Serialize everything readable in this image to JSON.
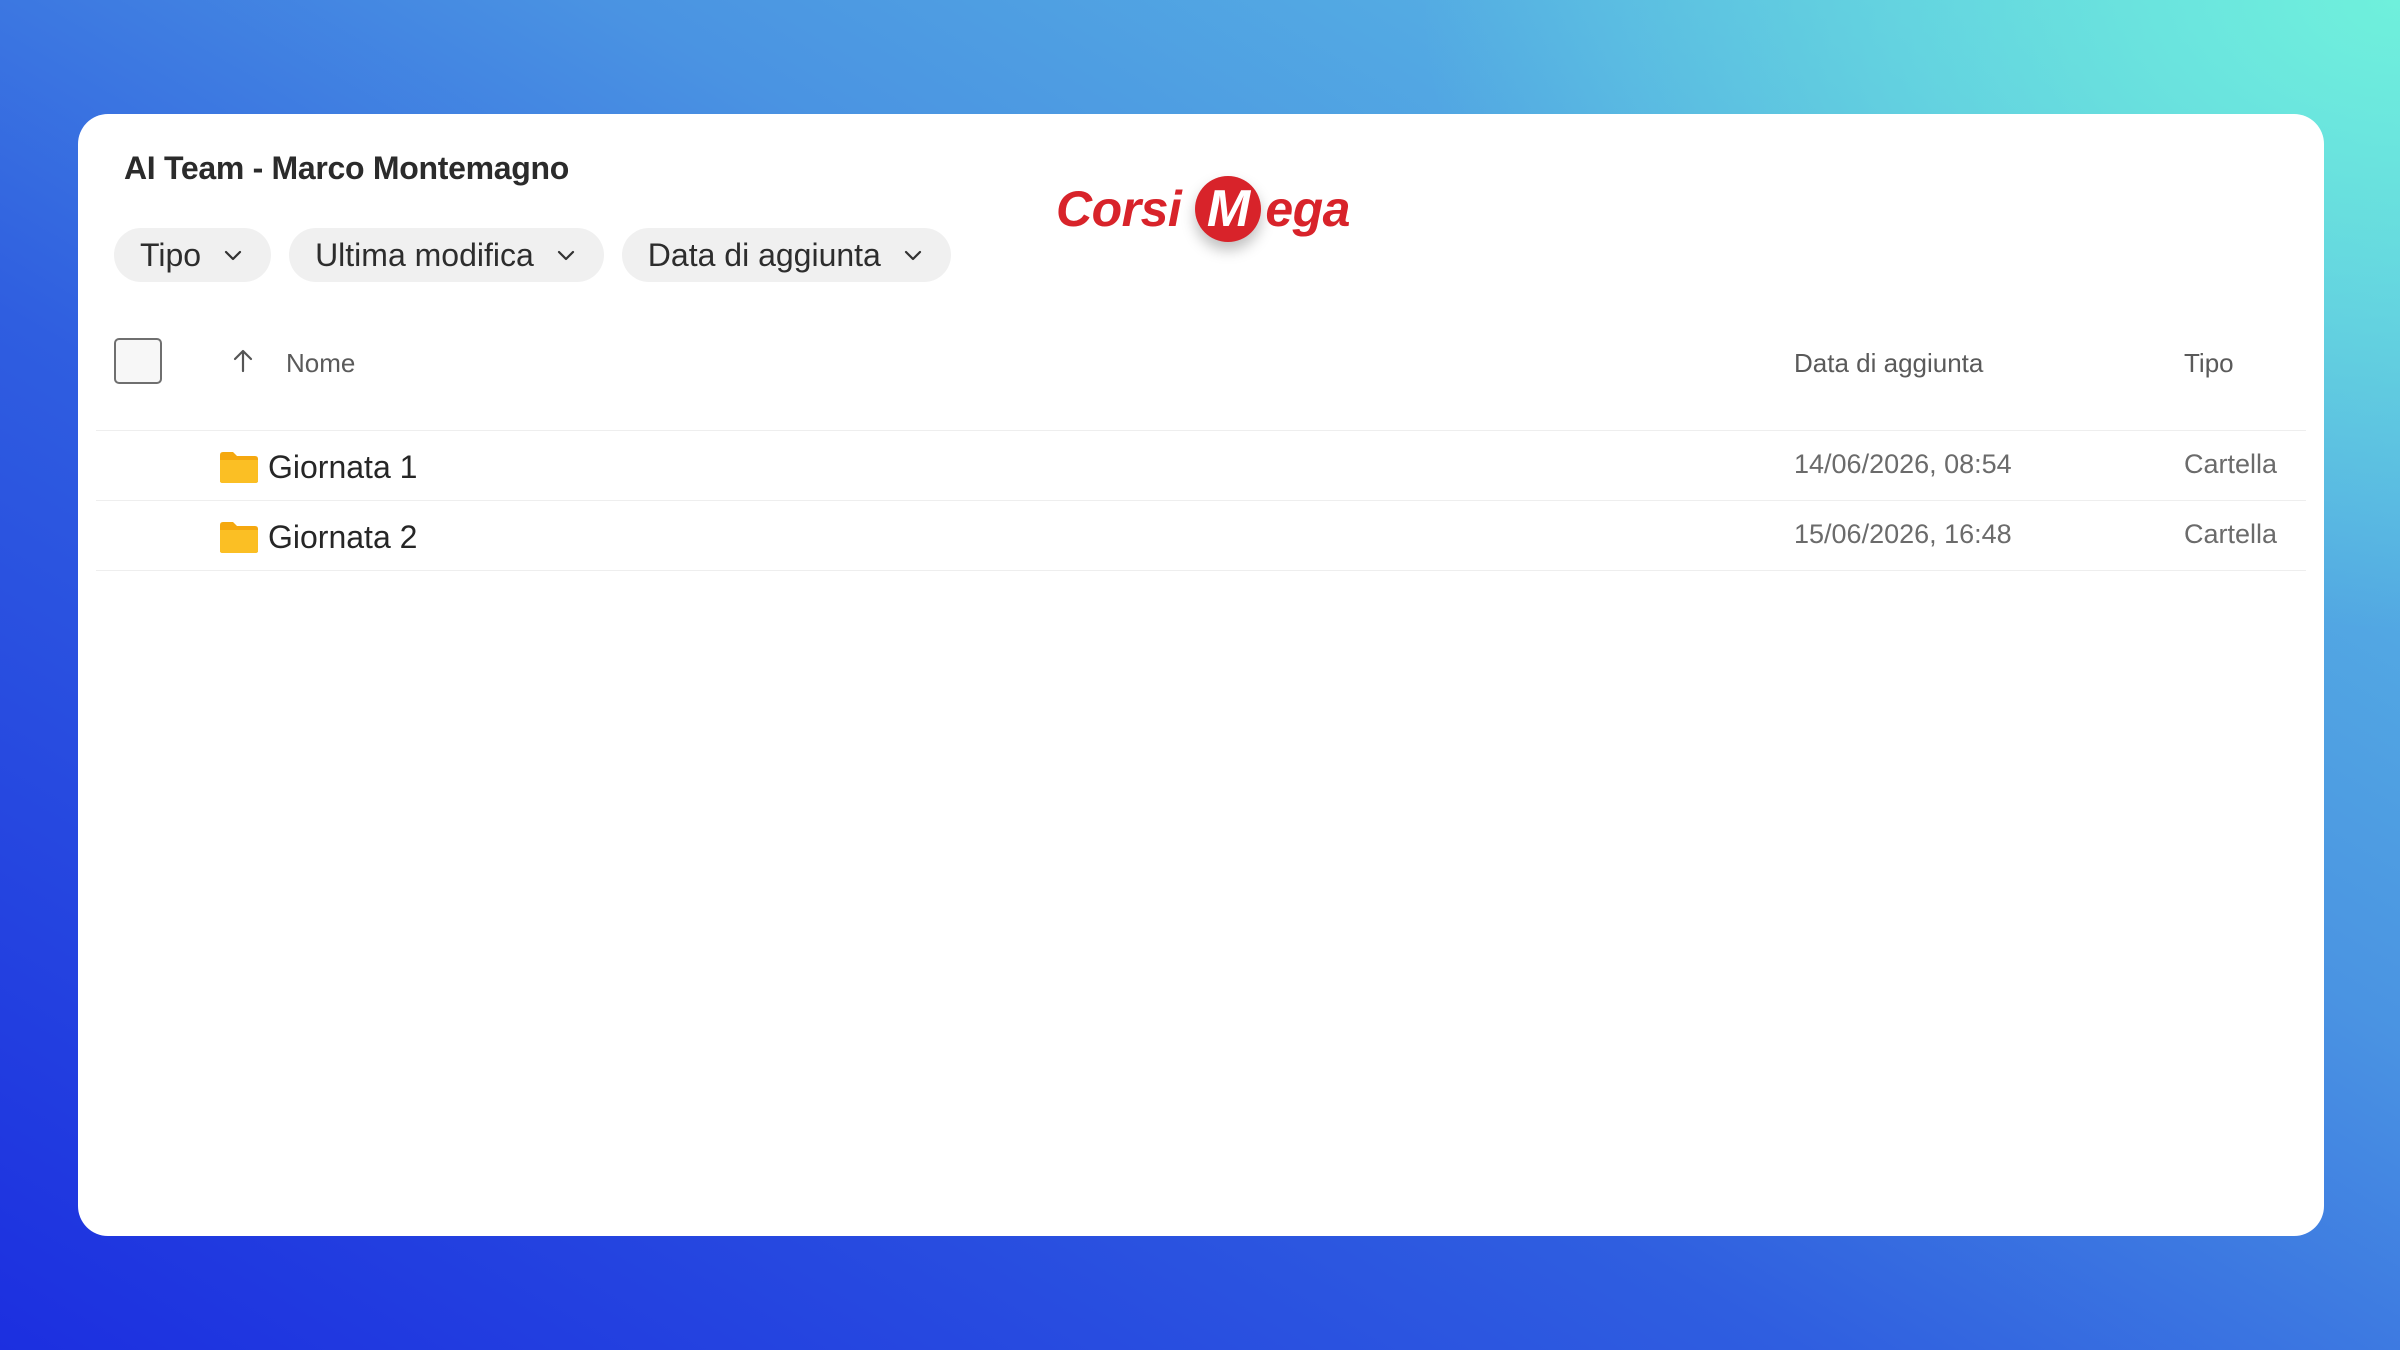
{
  "window": {
    "title": "AI Team - Marco Montemagno"
  },
  "filters": [
    {
      "label": "Tipo",
      "icon": "chevron-down-icon"
    },
    {
      "label": "Ultima modifica",
      "icon": "chevron-down-icon"
    },
    {
      "label": "Data di aggiunta",
      "icon": "chevron-down-icon"
    }
  ],
  "watermark": {
    "text_left": "Corsi",
    "badge_letter": "M",
    "text_right": "ega",
    "color": "#d8232a"
  },
  "table": {
    "sort_icon": "arrow-up-icon",
    "columns": {
      "name": "Nome",
      "date_added": "Data di aggiunta",
      "type": "Tipo"
    },
    "rows": [
      {
        "icon": "folder-icon",
        "name": "Giornata 1",
        "date_added": "14/06/2026, 08:54",
        "type": "Cartella"
      },
      {
        "icon": "folder-icon",
        "name": "Giornata 2",
        "date_added": "15/06/2026, 16:48",
        "type": "Cartella"
      }
    ]
  },
  "colors": {
    "folder": "#f9b917",
    "panel": "#ffffff",
    "chip": "#f0f0f0"
  }
}
